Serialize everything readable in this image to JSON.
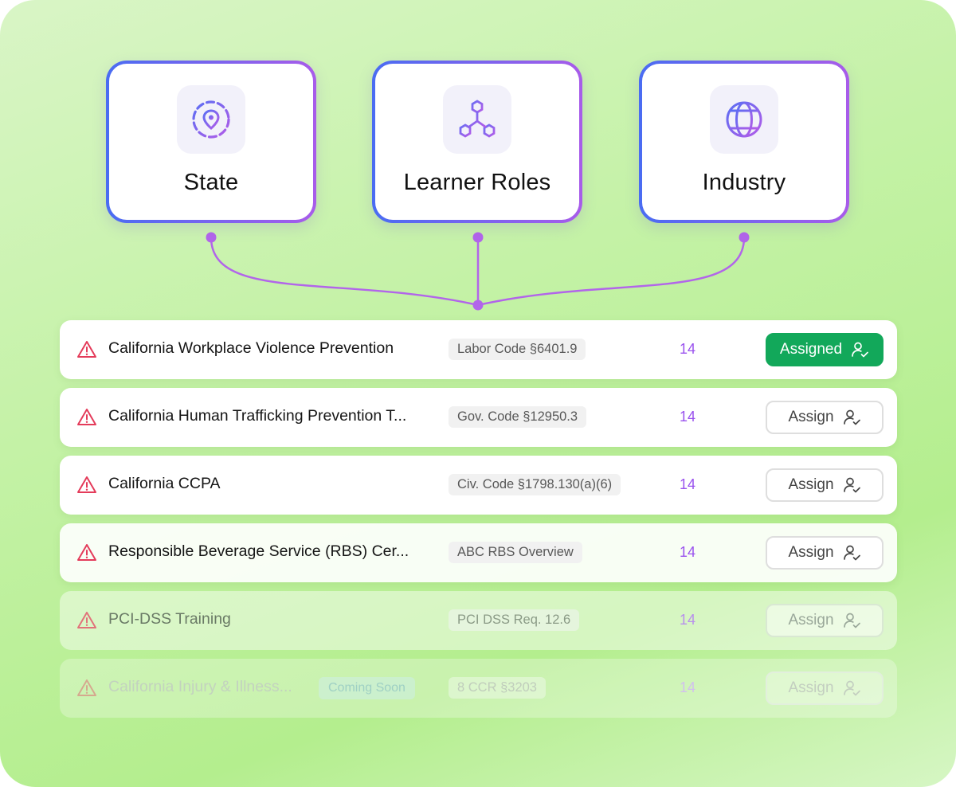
{
  "colors": {
    "card_gradient_start": "#4a6cf2",
    "card_gradient_end": "#a85cea",
    "connector": "#b265ea",
    "count": "#9a52ee",
    "warning": "#e43b5a",
    "assigned_bg": "#12a85a"
  },
  "categories": [
    {
      "label": "State",
      "icon": "location-pin-dashed-ring-icon"
    },
    {
      "label": "Learner Roles",
      "icon": "hierarchy-nodes-icon"
    },
    {
      "label": "Industry",
      "icon": "globe-icon"
    }
  ],
  "rows": [
    {
      "title": "California Workplace Violence Prevention",
      "badge": "",
      "code": "Labor Code §6401.9",
      "count": "14",
      "button": "Assigned",
      "assigned": true
    },
    {
      "title": "California Human Trafficking Prevention T...",
      "badge": "",
      "code": "Gov. Code §12950.3",
      "count": "14",
      "button": "Assign",
      "assigned": false
    },
    {
      "title": "California CCPA",
      "badge": "",
      "code": "Civ. Code §1798.130(a)(6)",
      "count": "14",
      "button": "Assign",
      "assigned": false
    },
    {
      "title": "Responsible Beverage Service (RBS) Cer...",
      "badge": "",
      "code": "ABC RBS Overview",
      "count": "14",
      "button": "Assign",
      "assigned": false
    },
    {
      "title": "PCI-DSS Training",
      "badge": "",
      "code": "PCI DSS Req. 12.6",
      "count": "14",
      "button": "Assign",
      "assigned": false
    },
    {
      "title": "California Injury & Illness...",
      "badge": "Coming Soon",
      "code": "8 CCR §3203",
      "count": "14",
      "button": "Assign",
      "assigned": false
    }
  ]
}
